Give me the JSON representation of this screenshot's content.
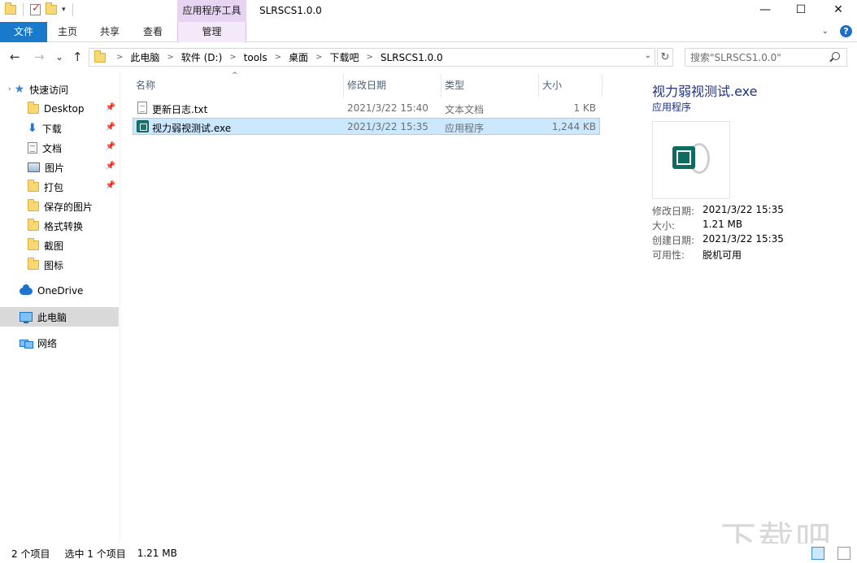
{
  "window": {
    "title": "SLRSCS1.0.0",
    "context_tab": "应用程序工具",
    "controls": {
      "minimize": "—",
      "maximize": "☐",
      "close": "✕"
    }
  },
  "ribbon": {
    "tabs": [
      "文件",
      "主页",
      "共享",
      "查看",
      "管理"
    ]
  },
  "address": {
    "back": "←",
    "forward": "→",
    "recent": "⌄",
    "up": "↑",
    "crumbs": [
      "此电脑",
      "软件 (D:)",
      "tools",
      "桌面",
      "下载吧",
      "SLRSCS1.0.0"
    ],
    "search_placeholder": "搜索\"SLRSCS1.0.0\""
  },
  "nav": {
    "quick_access": "快速访问",
    "items": [
      {
        "label": "Desktop",
        "pinned": true
      },
      {
        "label": "下载",
        "pinned": true
      },
      {
        "label": "文档",
        "pinned": true
      },
      {
        "label": "图片",
        "pinned": true
      },
      {
        "label": "打包",
        "pinned": true
      },
      {
        "label": "保存的图片"
      },
      {
        "label": "格式转换"
      },
      {
        "label": "截图"
      },
      {
        "label": "图标"
      }
    ],
    "onedrive": "OneDrive",
    "this_pc": "此电脑",
    "network": "网络"
  },
  "columns": {
    "name": "名称",
    "date": "修改日期",
    "type": "类型",
    "size": "大小"
  },
  "files": [
    {
      "name": "更新日志.txt",
      "date": "2021/3/22 15:40",
      "type": "文本文档",
      "size": "1 KB",
      "icon": "txt-file-icon"
    },
    {
      "name": "视力弱视测试.exe",
      "date": "2021/3/22 15:35",
      "type": "应用程序",
      "size": "1,244 KB",
      "icon": "exe-file-icon",
      "selected": true
    }
  ],
  "preview": {
    "title": "视力弱视测试.exe",
    "subtitle": "应用程序",
    "props": [
      {
        "k": "修改日期:",
        "v": "2021/3/22 15:35"
      },
      {
        "k": "大小:",
        "v": "1.21 MB"
      },
      {
        "k": "创建日期:",
        "v": "2021/3/22 15:35"
      },
      {
        "k": "可用性:",
        "v": "脱机可用"
      }
    ]
  },
  "status": {
    "count": "2 个项目",
    "selection": "选中 1 个项目",
    "size": "1.21 MB"
  },
  "watermark": "下载吧"
}
